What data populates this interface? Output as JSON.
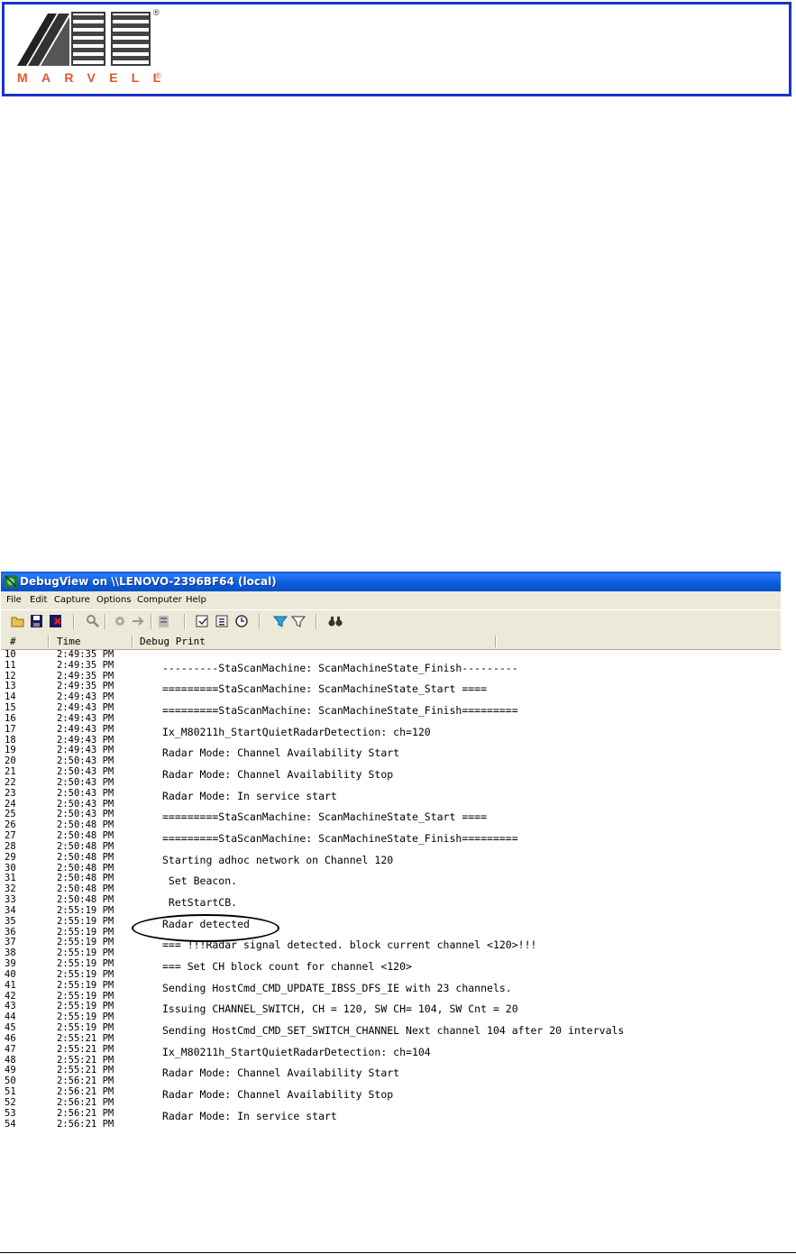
{
  "header": {
    "logo_text": "MARVELL",
    "registered_mark": "®"
  },
  "window": {
    "title": "DebugView on \\\\LENOVO-2396BF64 (local)",
    "menu": [
      "File",
      "Edit",
      "Capture",
      "Options",
      "Computer",
      "Help"
    ],
    "toolbar_icons": [
      "open-icon",
      "save-icon",
      "clear-log-icon",
      "capture-icon",
      "capture-kernel-icon",
      "pass-through-icon",
      "log-to-file-icon",
      "autoscroll-icon",
      "clock-icon",
      "filter-icon",
      "highlight-icon",
      "find-icon"
    ],
    "columns": [
      "#",
      "Time",
      "Debug Print"
    ],
    "rows": [
      {
        "num": "10",
        "time": "2:49:35 PM",
        "msg": ""
      },
      {
        "num": "11",
        "time": "2:49:35 PM",
        "msg": "---------StaScanMachine: ScanMachineState_Finish---------"
      },
      {
        "num": "12",
        "time": "2:49:35 PM",
        "msg": ""
      },
      {
        "num": "13",
        "time": "2:49:35 PM",
        "msg": "=========StaScanMachine: ScanMachineState_Start ===="
      },
      {
        "num": "14",
        "time": "2:49:43 PM",
        "msg": ""
      },
      {
        "num": "15",
        "time": "2:49:43 PM",
        "msg": "=========StaScanMachine: ScanMachineState_Finish========="
      },
      {
        "num": "16",
        "time": "2:49:43 PM",
        "msg": ""
      },
      {
        "num": "17",
        "time": "2:49:43 PM",
        "msg": "Ix_M80211h_StartQuietRadarDetection: ch=120"
      },
      {
        "num": "18",
        "time": "2:49:43 PM",
        "msg": ""
      },
      {
        "num": "19",
        "time": "2:49:43 PM",
        "msg": "Radar Mode: Channel Availability Start"
      },
      {
        "num": "20",
        "time": "2:50:43 PM",
        "msg": ""
      },
      {
        "num": "21",
        "time": "2:50:43 PM",
        "msg": "Radar Mode: Channel Availability Stop"
      },
      {
        "num": "22",
        "time": "2:50:43 PM",
        "msg": ""
      },
      {
        "num": "23",
        "time": "2:50:43 PM",
        "msg": "Radar Mode: In service start"
      },
      {
        "num": "24",
        "time": "2:50:43 PM",
        "msg": ""
      },
      {
        "num": "25",
        "time": "2:50:43 PM",
        "msg": "=========StaScanMachine: ScanMachineState_Start ===="
      },
      {
        "num": "26",
        "time": "2:50:48 PM",
        "msg": ""
      },
      {
        "num": "27",
        "time": "2:50:48 PM",
        "msg": "=========StaScanMachine: ScanMachineState_Finish========="
      },
      {
        "num": "28",
        "time": "2:50:48 PM",
        "msg": ""
      },
      {
        "num": "29",
        "time": "2:50:48 PM",
        "msg": "Starting adhoc network on Channel 120"
      },
      {
        "num": "30",
        "time": "2:50:48 PM",
        "msg": ""
      },
      {
        "num": "31",
        "time": "2:50:48 PM",
        "msg": " Set Beacon."
      },
      {
        "num": "32",
        "time": "2:50:48 PM",
        "msg": ""
      },
      {
        "num": "33",
        "time": "2:50:48 PM",
        "msg": " RetStartCB."
      },
      {
        "num": "34",
        "time": "2:55:19 PM",
        "msg": ""
      },
      {
        "num": "35",
        "time": "2:55:19 PM",
        "msg": "Radar detected"
      },
      {
        "num": "36",
        "time": "2:55:19 PM",
        "msg": ""
      },
      {
        "num": "37",
        "time": "2:55:19 PM",
        "msg": "=== !!!Radar signal detected. block current channel <120>!!!"
      },
      {
        "num": "38",
        "time": "2:55:19 PM",
        "msg": ""
      },
      {
        "num": "39",
        "time": "2:55:19 PM",
        "msg": "=== Set CH block count for channel <120>"
      },
      {
        "num": "40",
        "time": "2:55:19 PM",
        "msg": ""
      },
      {
        "num": "41",
        "time": "2:55:19 PM",
        "msg": "Sending HostCmd_CMD_UPDATE_IBSS_DFS_IE with 23 channels."
      },
      {
        "num": "42",
        "time": "2:55:19 PM",
        "msg": ""
      },
      {
        "num": "43",
        "time": "2:55:19 PM",
        "msg": "Issuing CHANNEL_SWITCH, CH = 120, SW CH= 104, SW Cnt = 20"
      },
      {
        "num": "44",
        "time": "2:55:19 PM",
        "msg": ""
      },
      {
        "num": "45",
        "time": "2:55:19 PM",
        "msg": "Sending HostCmd_CMD_SET_SWITCH_CHANNEL Next channel 104 after 20 intervals"
      },
      {
        "num": "46",
        "time": "2:55:21 PM",
        "msg": ""
      },
      {
        "num": "47",
        "time": "2:55:21 PM",
        "msg": "Ix_M80211h_StartQuietRadarDetection: ch=104"
      },
      {
        "num": "48",
        "time": "2:55:21 PM",
        "msg": ""
      },
      {
        "num": "49",
        "time": "2:55:21 PM",
        "msg": "Radar Mode: Channel Availability Start"
      },
      {
        "num": "50",
        "time": "2:56:21 PM",
        "msg": ""
      },
      {
        "num": "51",
        "time": "2:56:21 PM",
        "msg": "Radar Mode: Channel Availability Stop"
      },
      {
        "num": "52",
        "time": "2:56:21 PM",
        "msg": ""
      },
      {
        "num": "53",
        "time": "2:56:21 PM",
        "msg": "Radar Mode: In service start"
      },
      {
        "num": "54",
        "time": "2:56:21 PM",
        "msg": ""
      }
    ],
    "highlighted_row": "35",
    "colors": {
      "titlebar": "#0a5ddc",
      "chrome": "#ece9d8",
      "header_border": "#1a33cc",
      "logo_orange": "#e0572b"
    }
  }
}
